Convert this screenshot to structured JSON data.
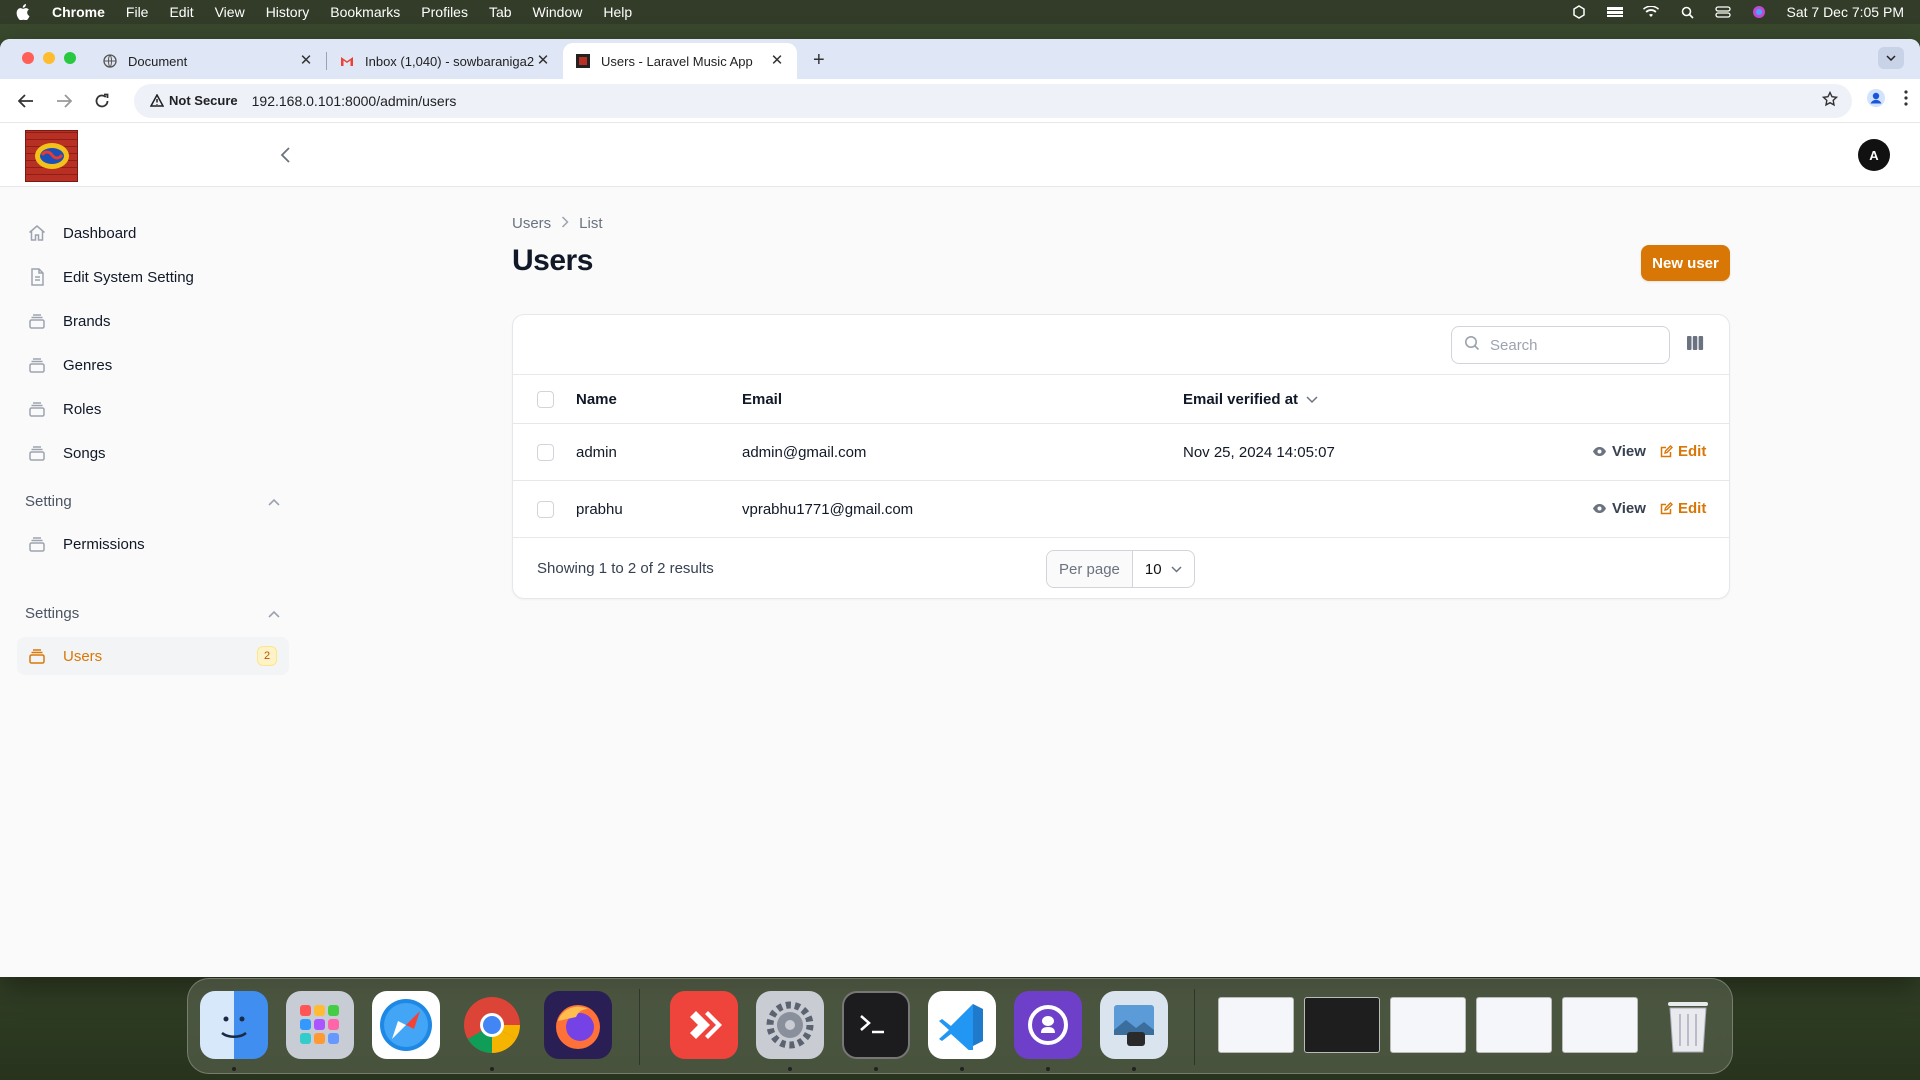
{
  "menubar": {
    "app": "Chrome",
    "items": [
      "File",
      "Edit",
      "View",
      "History",
      "Bookmarks",
      "Profiles",
      "Tab",
      "Window",
      "Help"
    ],
    "datetime": "Sat 7 Dec  7:05 PM"
  },
  "browser": {
    "tabs": [
      {
        "title": "Document",
        "icon": "globe-icon"
      },
      {
        "title": "Inbox (1,040) - sowbaraniga2",
        "icon": "gmail-icon"
      },
      {
        "title": "Users - Laravel Music App",
        "icon": "app-favicon",
        "active": true
      }
    ],
    "security_label": "Not Secure",
    "url": "192.168.0.101:8000/admin/users"
  },
  "app": {
    "avatar_initial": "A",
    "sidebar": {
      "items": [
        {
          "label": "Dashboard",
          "icon": "home-icon"
        },
        {
          "label": "Edit System Setting",
          "icon": "document-icon"
        },
        {
          "label": "Brands",
          "icon": "rectangle-stack-icon"
        },
        {
          "label": "Genres",
          "icon": "rectangle-stack-icon"
        },
        {
          "label": "Roles",
          "icon": "rectangle-stack-icon"
        },
        {
          "label": "Songs",
          "icon": "rectangle-stack-icon"
        }
      ],
      "groups": [
        {
          "label": "Setting",
          "items": [
            {
              "label": "Permissions",
              "icon": "rectangle-stack-icon"
            }
          ]
        },
        {
          "label": "Settings",
          "items": [
            {
              "label": "Users",
              "icon": "rectangle-stack-icon",
              "badge": "2",
              "active": true
            }
          ]
        }
      ]
    },
    "breadcrumb": [
      "Users",
      "List"
    ],
    "title": "Users",
    "new_button": "New user",
    "search_placeholder": "Search",
    "table": {
      "columns": [
        "Name",
        "Email",
        "Email verified at"
      ],
      "rows": [
        {
          "name": "admin",
          "email": "admin@gmail.com",
          "verified": "Nov 25, 2024 14:05:07"
        },
        {
          "name": "prabhu",
          "email": "vprabhu1771@gmail.com",
          "verified": ""
        }
      ],
      "row_actions": {
        "view": "View",
        "edit": "Edit"
      },
      "results_text": "Showing 1 to 2 of 2 results",
      "per_page_label": "Per page",
      "per_page_value": "10"
    },
    "colors": {
      "primary": "#d97706"
    }
  },
  "dock": {
    "apps": [
      "Finder",
      "Launchpad",
      "Safari",
      "Google Chrome",
      "Firefox",
      "AnyDesk",
      "System Settings",
      "Terminal",
      "Visual Studio Code",
      "GitHub Desktop",
      "Preview"
    ]
  }
}
